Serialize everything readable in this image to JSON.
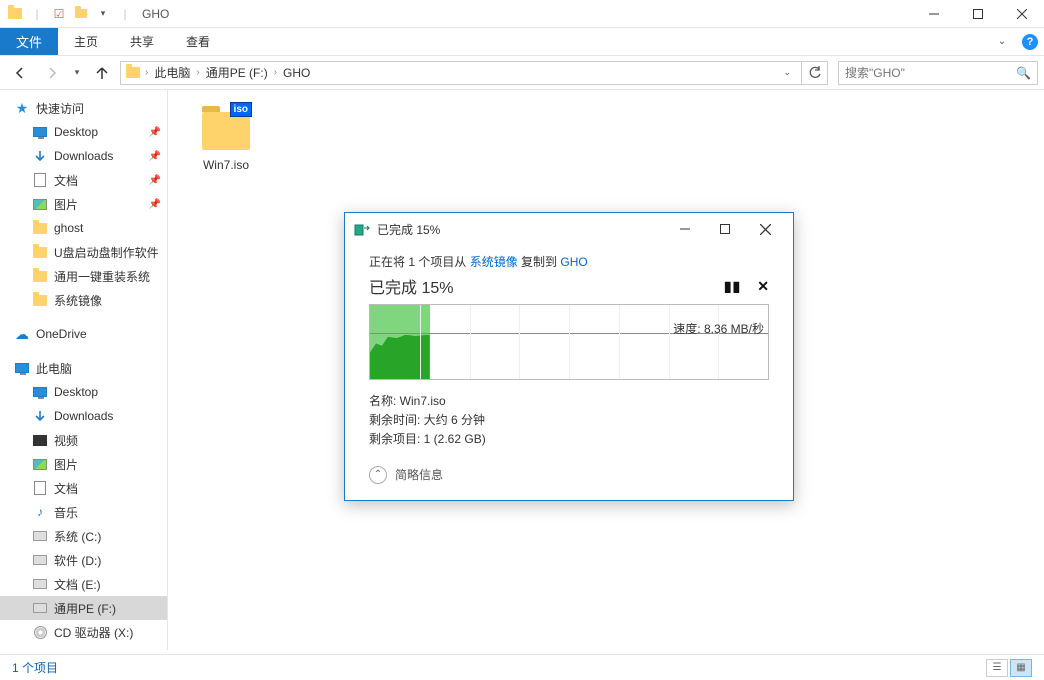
{
  "window": {
    "title": "GHO"
  },
  "ribbon": {
    "file": "文件",
    "home": "主页",
    "share": "共享",
    "view": "查看"
  },
  "nav": {
    "path": [
      "此电脑",
      "通用PE (F:)",
      "GHO"
    ],
    "search_placeholder": "搜索\"GHO\""
  },
  "sidebar": {
    "quick": {
      "label": "快速访问",
      "items": [
        {
          "label": "Desktop",
          "icon": "monitor",
          "pin": true
        },
        {
          "label": "Downloads",
          "icon": "down",
          "pin": true
        },
        {
          "label": "文档",
          "icon": "doc",
          "pin": true
        },
        {
          "label": "图片",
          "icon": "pic",
          "pin": true
        },
        {
          "label": "ghost",
          "icon": "folder",
          "pin": false
        },
        {
          "label": "U盘启动盘制作软件",
          "icon": "folder",
          "pin": false
        },
        {
          "label": "通用一键重装系统",
          "icon": "folder",
          "pin": false
        },
        {
          "label": "系统镜像",
          "icon": "folder",
          "pin": false
        }
      ]
    },
    "onedrive": "OneDrive",
    "pc": {
      "label": "此电脑",
      "items": [
        {
          "label": "Desktop",
          "icon": "monitor"
        },
        {
          "label": "Downloads",
          "icon": "down"
        },
        {
          "label": "视频",
          "icon": "video"
        },
        {
          "label": "图片",
          "icon": "pic"
        },
        {
          "label": "文档",
          "icon": "doc"
        },
        {
          "label": "音乐",
          "icon": "music"
        },
        {
          "label": "系统 (C:)",
          "icon": "drive"
        },
        {
          "label": "软件 (D:)",
          "icon": "drive"
        },
        {
          "label": "文档 (E:)",
          "icon": "drive"
        },
        {
          "label": "通用PE (F:)",
          "icon": "drive",
          "sel": true
        },
        {
          "label": "CD 驱动器 (X:)",
          "icon": "disc"
        }
      ]
    }
  },
  "files": [
    {
      "name": "Win7.iso"
    }
  ],
  "status": {
    "count": "1 个项目"
  },
  "dialog": {
    "title": "已完成 15%",
    "copy_prefix": "正在将 1 个项目从 ",
    "src": "系统镜像",
    "copy_mid": " 复制到 ",
    "dst": "GHO",
    "progress_title": "已完成 15%",
    "speed": "速度: 8.36 MB/秒",
    "name_line": "名称: Win7.iso",
    "time_line": "剩余时间: 大约 6 分钟",
    "remain_line": "剩余项目: 1 (2.62 GB)",
    "details": "简略信息"
  }
}
